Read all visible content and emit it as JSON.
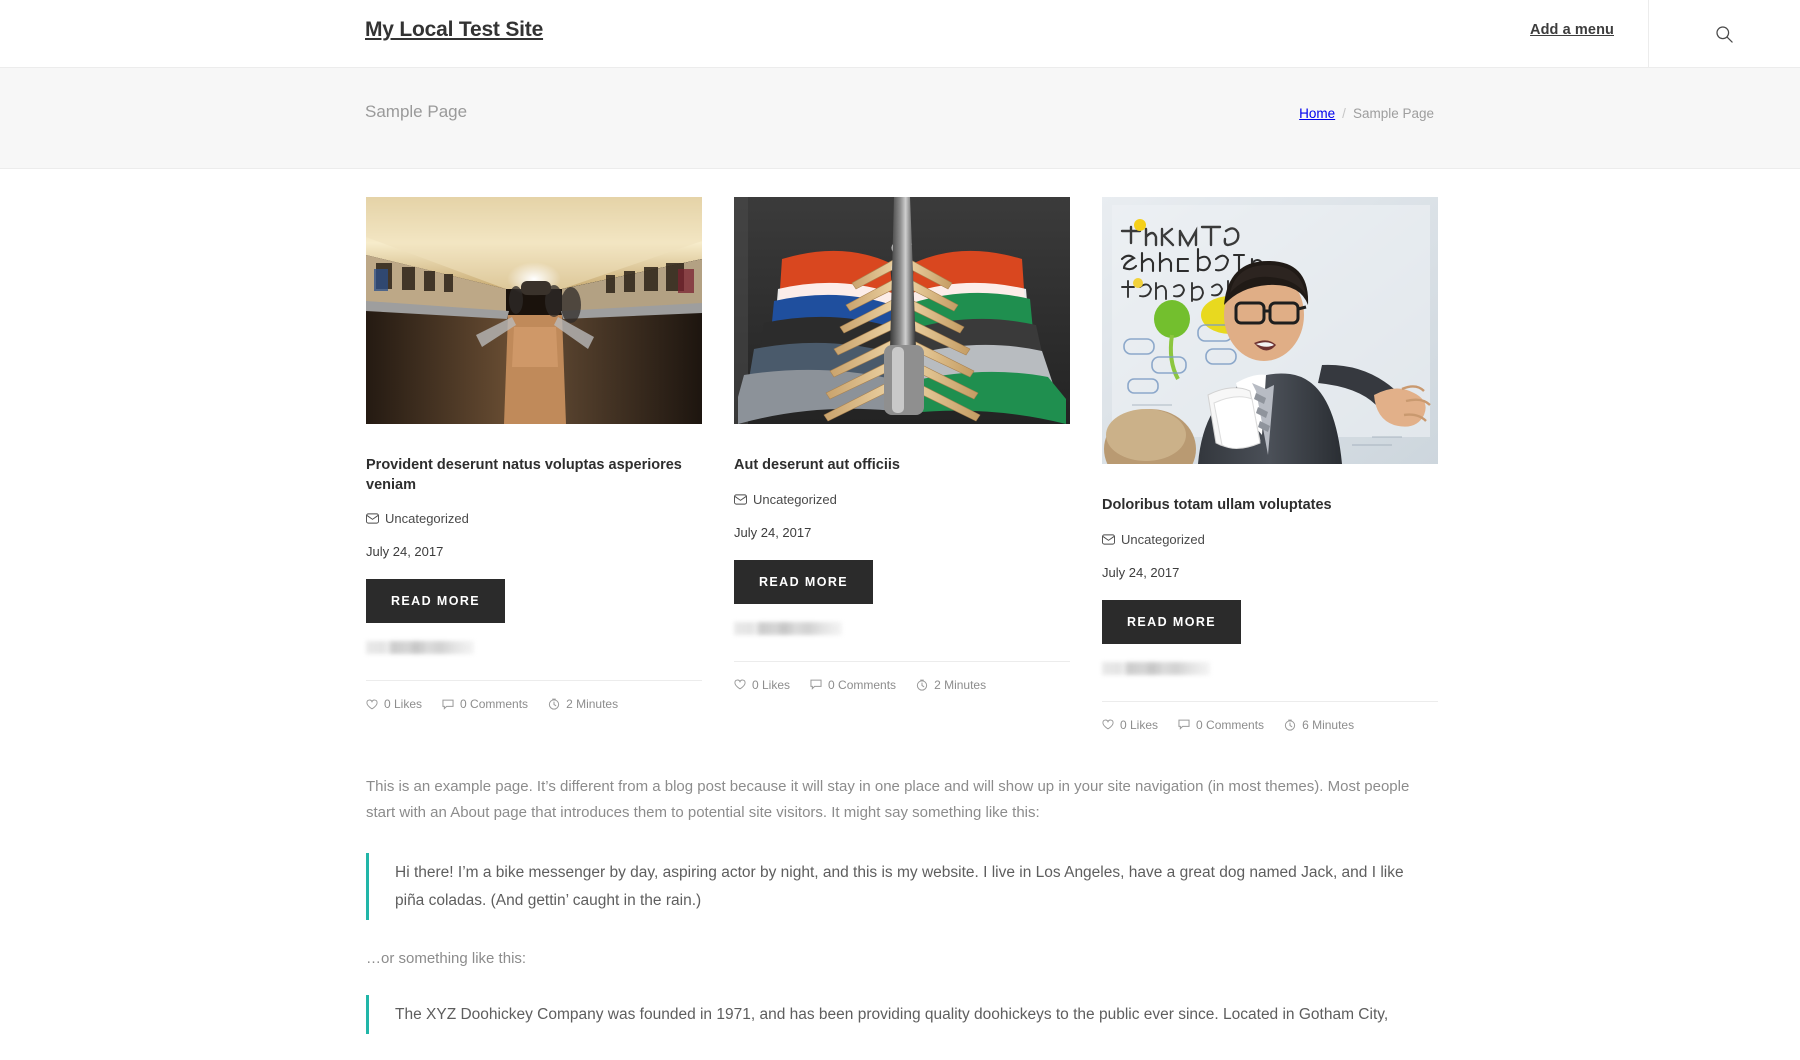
{
  "header": {
    "site_title": "My Local Test Site",
    "menu_label": "Add a menu",
    "search_icon": "search-icon"
  },
  "page_bar": {
    "title": "Sample Page",
    "breadcrumb": {
      "home": "Home",
      "separator": "/",
      "current": "Sample Page"
    }
  },
  "posts": [
    {
      "title": "Provident deserunt natus voluptas asperiores veniam",
      "category": "Uncategorized",
      "category_icon": "envelope-icon",
      "date": "July 24, 2017",
      "read_more": "READ MORE",
      "image_alt": "subway-escalator-tunnel",
      "likes": "0 Likes",
      "comments": "0 Comments",
      "read_time": "2 Minutes"
    },
    {
      "title": "Aut deserunt aut officiis",
      "category": "Uncategorized",
      "category_icon": "envelope-icon",
      "date": "July 24, 2017",
      "read_more": "READ MORE",
      "image_alt": "clothes-on-hangers-rack",
      "likes": "0 Likes",
      "comments": "0 Comments",
      "read_time": "2 Minutes"
    },
    {
      "title": "Doloribus totam ullam voluptates",
      "category": "Uncategorized",
      "category_icon": "envelope-icon",
      "date": "July 24, 2017",
      "read_more": "READ MORE",
      "image_alt": "man-presenting-at-whiteboard-think-tank",
      "likes": "0 Likes",
      "comments": "0 Comments",
      "read_time": "6 Minutes"
    }
  ],
  "body": {
    "intro": "This is an example page. It’s different from a blog post because it will stay in one place and will show up in your site navigation (in most themes). Most people start with an About page that introduces them to potential site visitors. It might say something like this:",
    "quote_one": "Hi there! I’m a bike messenger by day, aspiring actor by night, and this is my website. I live in Los Angeles, have a great dog named Jack, and I like piña coladas. (And gettin’ caught in the rain.)",
    "or_line": "…or something like this:",
    "quote_two": "The XYZ Doohickey Company was founded in 1971, and has been providing quality doohickeys to the public ever since. Located in Gotham City,"
  },
  "colors": {
    "accent": "#21b6a8",
    "button_bg": "#2b2b2b",
    "page_bar_bg": "#f7f7f7",
    "body_text": "#8c8c8c"
  }
}
